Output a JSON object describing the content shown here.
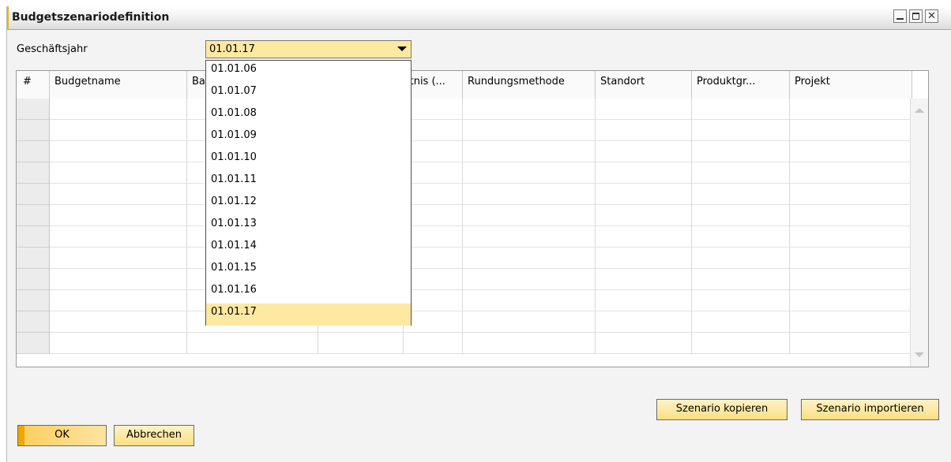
{
  "window": {
    "title": "Budgetszenariodefinition",
    "close_glyph": "✕"
  },
  "fiscal_year": {
    "label": "Geschäftsjahr",
    "value": "01.01.17",
    "options": [
      "01.01.06",
      "01.01.07",
      "01.01.08",
      "01.01.09",
      "01.01.10",
      "01.01.11",
      "01.01.12",
      "01.01.13",
      "01.01.14",
      "01.01.15",
      "01.01.16",
      "01.01.17"
    ],
    "selected_index": 11
  },
  "grid": {
    "columns": [
      "#",
      "Budgetname",
      "Ba",
      "",
      "ltnis (...",
      "Rundungsmethode",
      "Standort",
      "Produktgr...",
      "Projekt"
    ],
    "row_count": 12
  },
  "buttons": {
    "copy": "Szenario kopieren",
    "import": "Szenario importieren",
    "ok": "OK",
    "cancel": "Abbrechen"
  },
  "colors": {
    "accent": "#f0a500",
    "highlight": "#fde9a2",
    "button_face": "#fbdf83"
  },
  "icons": {
    "minimize": "minimize-icon",
    "maximize": "maximize-icon",
    "close": "close-icon",
    "dropdown": "chevron-down-icon"
  }
}
